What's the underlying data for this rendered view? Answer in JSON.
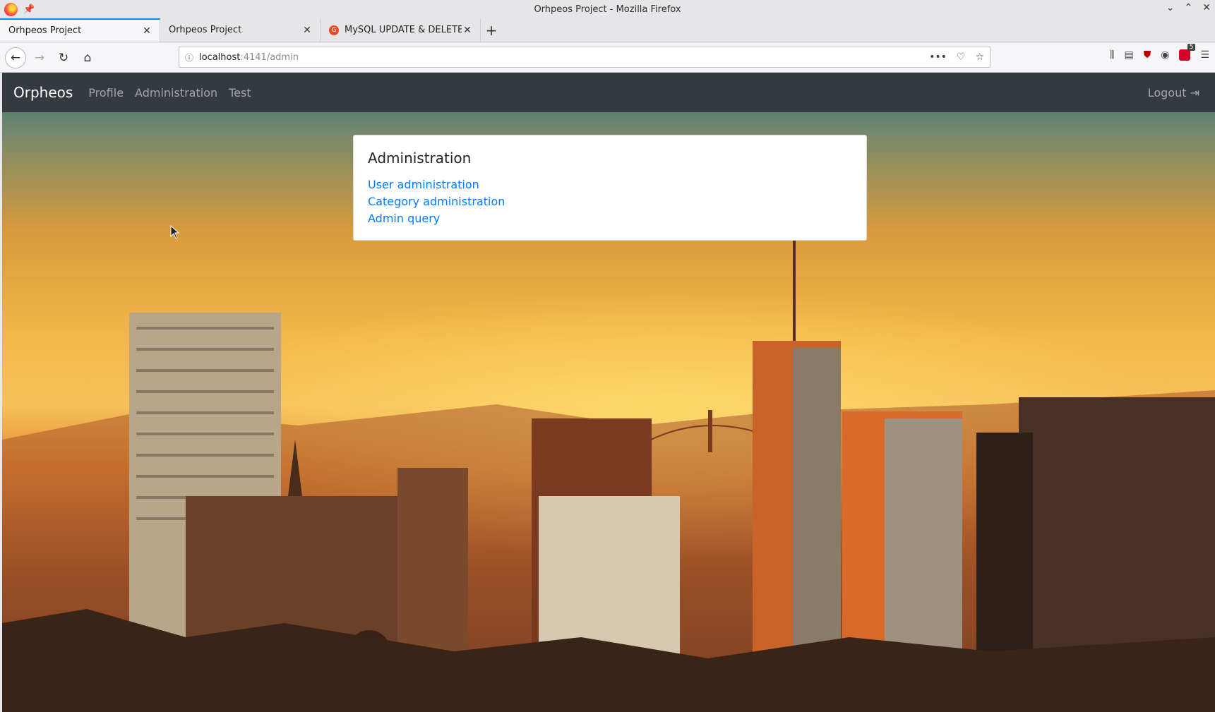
{
  "window": {
    "title": "Orhpeos Project - Mozilla Firefox"
  },
  "tabs": [
    {
      "label": "Orhpeos Project",
      "active": true
    },
    {
      "label": "Orhpeos Project",
      "active": false
    },
    {
      "label": "MySQL UPDATE & DELETE",
      "active": false
    }
  ],
  "toolbar": {
    "url_host": "localhost",
    "url_path": ":4141/admin",
    "extension_badge": "5"
  },
  "app": {
    "brand": "Orpheos",
    "nav": [
      "Profile",
      "Administration",
      "Test"
    ],
    "logout": "Logout"
  },
  "card": {
    "title": "Administration",
    "links": [
      "User administration",
      "Category administration",
      "Admin query"
    ]
  },
  "colors": {
    "navbar": "#343a40",
    "link": "#007bff",
    "tab_accent": "#0a84ff"
  }
}
